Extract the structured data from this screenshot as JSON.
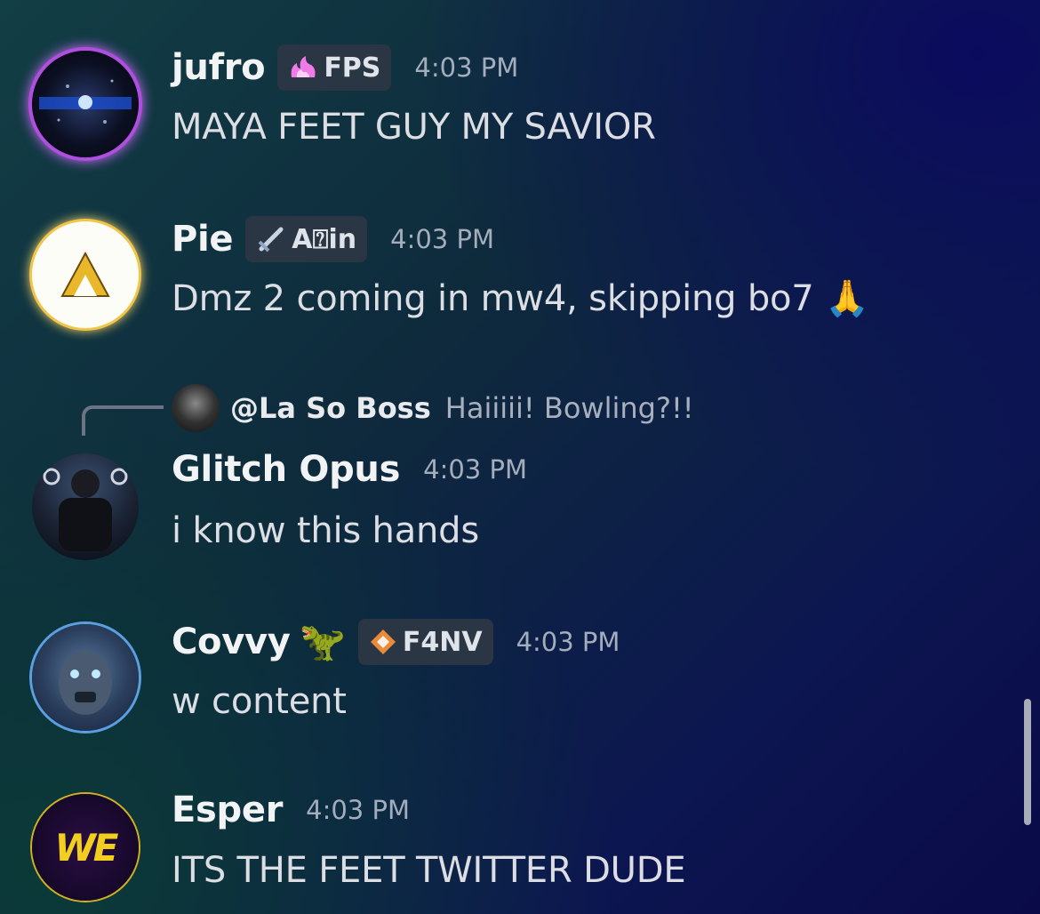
{
  "messages": [
    {
      "username": "jufro",
      "tag": "FPS",
      "time": "4:03 PM",
      "text": "MAYA FEET GUY MY SAVIOR",
      "tag_icon": "pink-flame-icon",
      "avatar_icon": "galaxy-avatar"
    },
    {
      "username": "Pie",
      "tag": "A⍰in",
      "time": "4:03 PM",
      "text": "Dmz 2 coming in mw4, skipping bo7 🙏",
      "tag_icon": "sword-icon",
      "avatar_icon": "triforce-avatar"
    },
    {
      "username": "Glitch Opus",
      "time": "4:03 PM",
      "text": "i know this hands",
      "avatar_icon": "soldier-avatar",
      "reply": {
        "name": "@La So Boss",
        "text": "Haiiiii! Bowling?!!"
      }
    },
    {
      "username": "Covvy",
      "tag": "F4NV",
      "time": "4:03 PM",
      "text": "w content",
      "name_emoji": "🦖",
      "tag_icon": "diamond-arrows-icon",
      "avatar_icon": "zombie-avatar"
    },
    {
      "username": "Esper",
      "time": "4:03 PM",
      "text": "ITS THE FEET TWITTER DUDE",
      "avatar_text": "WE"
    }
  ],
  "colors": {
    "background": "#0c1a40",
    "username": "#f2f3f5",
    "timestamp": "#a4adbb",
    "tag_bg": "#2a3644"
  }
}
